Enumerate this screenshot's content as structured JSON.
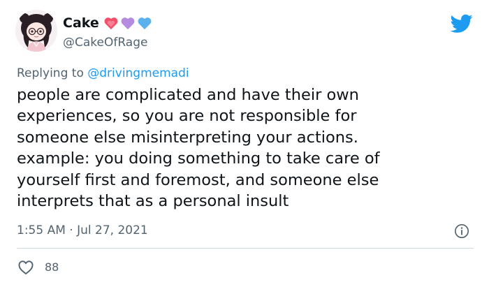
{
  "author": {
    "display_name": "Cake",
    "handle": "@CakeOfRage",
    "hearts": [
      "red-heart-icon",
      "purple-heart-icon",
      "blue-heart-icon"
    ],
    "heart_colors": [
      "#f2506a",
      "#b48be0",
      "#5ab1ee"
    ]
  },
  "reply": {
    "prefix": "Replying to ",
    "mention": "@drivingmemadi"
  },
  "tweet": {
    "lines": [
      "people are complicated and have their own",
      "experiences, so you are not responsible for",
      "someone else misinterpreting your actions.",
      "example: you doing something to take care of",
      "yourself first and foremost, and someone else",
      "interprets that as a personal insult"
    ],
    "timestamp": "1:55 AM · Jul 27, 2021"
  },
  "stats": {
    "likes": "88"
  },
  "colors": {
    "twitter_blue": "#1d9bf0",
    "secondary_text": "#536471",
    "primary_text": "#0f1419",
    "divider": "#cfd9de"
  },
  "icons": {
    "brand": "twitter-bird-icon",
    "info": "info-icon",
    "like": "heart-outline-icon"
  }
}
